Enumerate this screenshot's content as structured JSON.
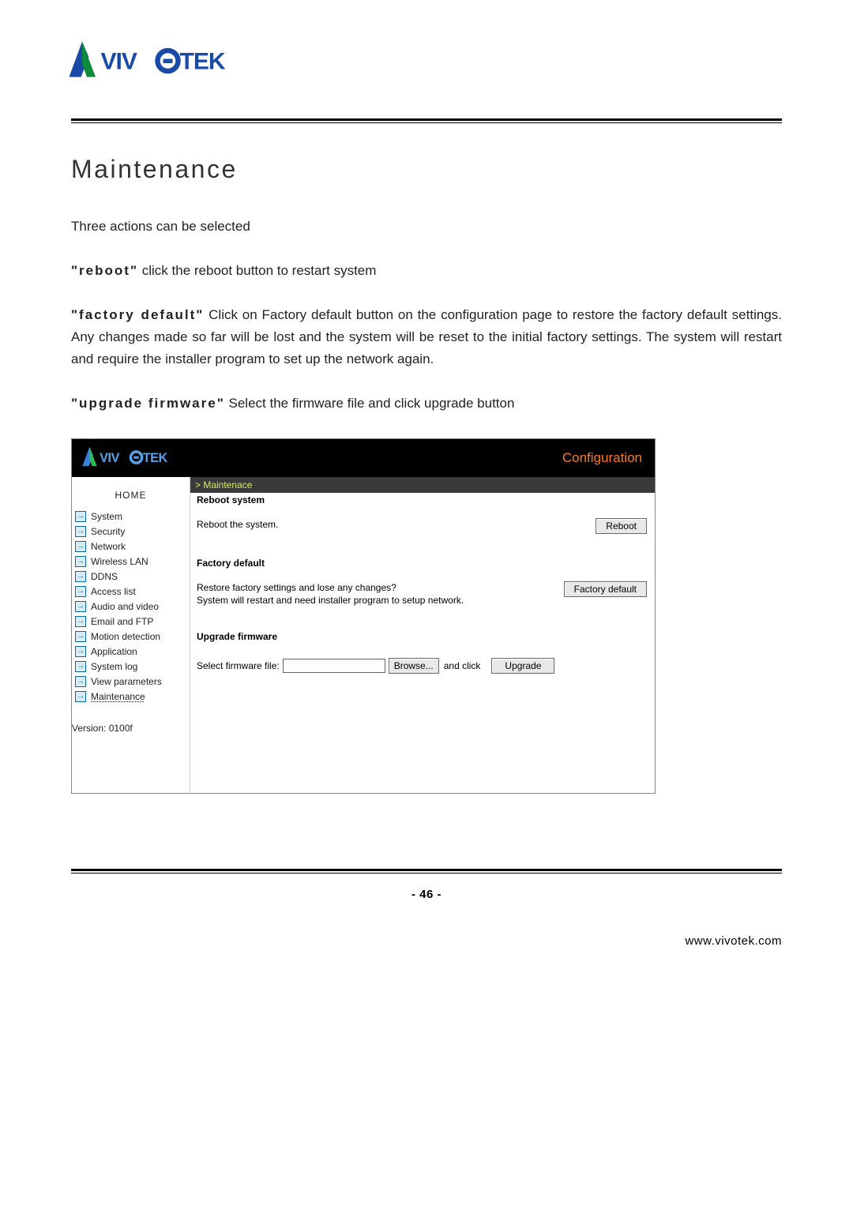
{
  "doc": {
    "section_title": "Maintenance",
    "intro": "Three actions can be selected",
    "p_reboot_term": "\"reboot\"",
    "p_reboot_rest": " click the reboot button to restart system",
    "p_factory_term": "\"factory default\"",
    "p_factory_rest": " Click on Factory default button on the configuration page to restore the factory default settings. Any changes made so far will be lost and the system will be reset to the initial factory settings. The system will restart and require the installer program to set up the network again.",
    "p_upgrade_term": "\"upgrade firmware\"",
    "p_upgrade_rest": " Select the firmware file and click upgrade button",
    "page_number": "- 46 -",
    "site_url": "www.vivotek.com"
  },
  "colors": {
    "accent_orange": "#ff7b1a",
    "crumb_bg": "#3a3a3a",
    "crumb_fg": "#d7e86f",
    "logo_blue": "#1a4aa8"
  },
  "shot": {
    "header_right": "Configuration",
    "crumb": "> Maintenace",
    "sidebar": {
      "home": "HOME",
      "items": [
        "System",
        "Security",
        "Network",
        "Wireless LAN",
        "DDNS",
        "Access list",
        "Audio and video",
        "Email and FTP",
        "Motion detection",
        "Application",
        "System log",
        "View parameters",
        "Maintenance"
      ],
      "active_index": 12,
      "version": "Version: 0100f"
    },
    "sections": {
      "reboot": {
        "heading": "Reboot system",
        "desc": "Reboot the system.",
        "button": "Reboot"
      },
      "factory": {
        "heading": "Factory default",
        "desc": "Restore factory settings and lose any changes?\nSystem will restart and need installer program to setup network.",
        "button": "Factory default"
      },
      "upgrade": {
        "heading": "Upgrade firmware",
        "file_label": "Select firmware file:",
        "browse": "Browse...",
        "and_click": "and click",
        "button": "Upgrade"
      }
    }
  }
}
